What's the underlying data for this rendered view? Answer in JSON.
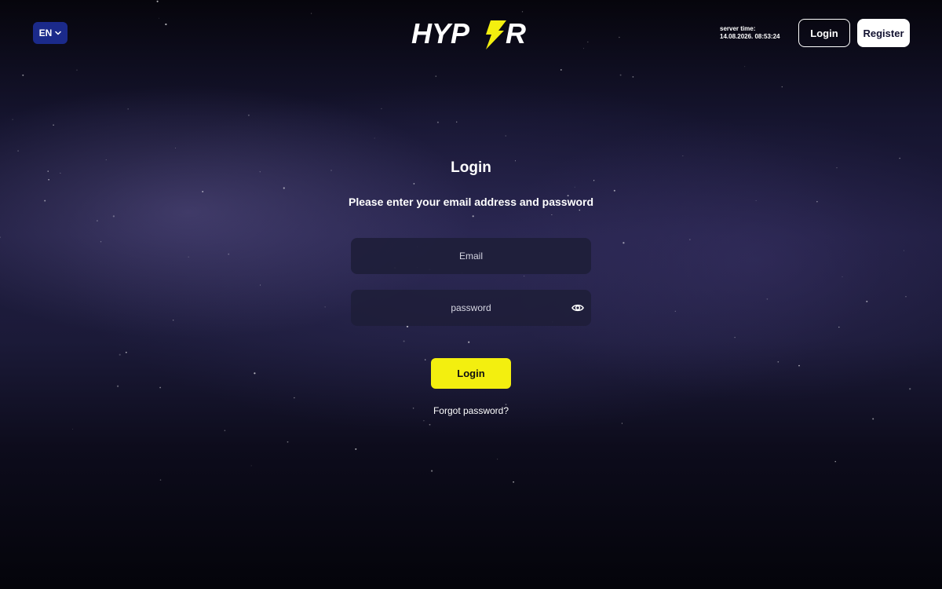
{
  "header": {
    "language": "EN",
    "logo_text": "HYPER",
    "server_time_label": "server time:",
    "server_time_value": "14.08.2026. 08:53:24",
    "login_label": "Login",
    "register_label": "Register"
  },
  "login_form": {
    "title": "Login",
    "subtitle": "Please enter your email address and password",
    "email_placeholder": "Email",
    "password_placeholder": "password",
    "submit_label": "Login",
    "forgot_label": "Forgot password?"
  },
  "icons": {
    "language_chevron": "chevron-down-icon",
    "password_visibility": "eye-icon",
    "logo_bolt": "lightning-bolt-icon"
  },
  "colors": {
    "accent_yellow": "#f3ef0f",
    "language_blue": "#1b2a8a",
    "field_background": "#1e1e3a"
  }
}
